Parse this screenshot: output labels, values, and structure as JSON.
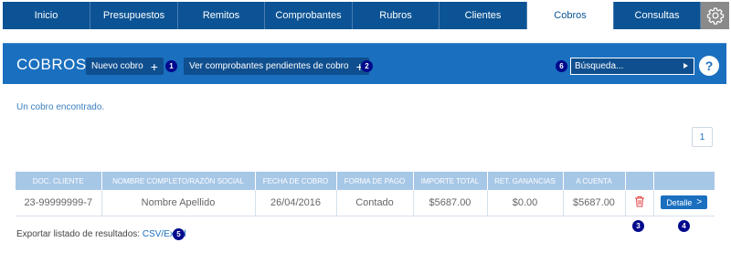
{
  "nav": {
    "tabs": [
      {
        "label": "Inicio"
      },
      {
        "label": "Presupuestos"
      },
      {
        "label": "Remitos"
      },
      {
        "label": "Comprobantes"
      },
      {
        "label": "Rubros"
      },
      {
        "label": "Clientes"
      },
      {
        "label": "Cobros"
      },
      {
        "label": "Consultas"
      }
    ]
  },
  "header": {
    "title": "COBROS",
    "new_button": "Nuevo cobro",
    "pending_button": "Ver comprobantes pendientes de cobro",
    "search_placeholder": "Búsqueda...",
    "help": "?"
  },
  "badges": [
    "1",
    "2",
    "3",
    "4",
    "5",
    "6"
  ],
  "results_text": "Un cobro encontrado.",
  "pagination": {
    "page": "1"
  },
  "table": {
    "headers": [
      "DOC. CLIENTE",
      "NOMBRE COMPLETO/RAZÓN SOCIAL",
      "FECHA DE COBRO",
      "FORMA DE PAGO",
      "IMPORTE TOTAL",
      "RET. GANANCIAS",
      "A CUENTA",
      "",
      ""
    ],
    "rows": [
      {
        "doc": "23-99999999-7",
        "name": "Nombre Apellido",
        "date": "26/04/2016",
        "payment": "Contado",
        "total": "$5687.00",
        "ret": "$0.00",
        "account": "$5687.00",
        "detail_label": "Detalle"
      }
    ]
  },
  "export": {
    "label": "Exportar listado de resultados:",
    "link": "CSV/Excel"
  },
  "colors": {
    "nav": "#0b5394",
    "header": "#1a6fbf",
    "table_head": "#a7c7e7",
    "badge": "#000a8c",
    "delete": "#e04040"
  }
}
